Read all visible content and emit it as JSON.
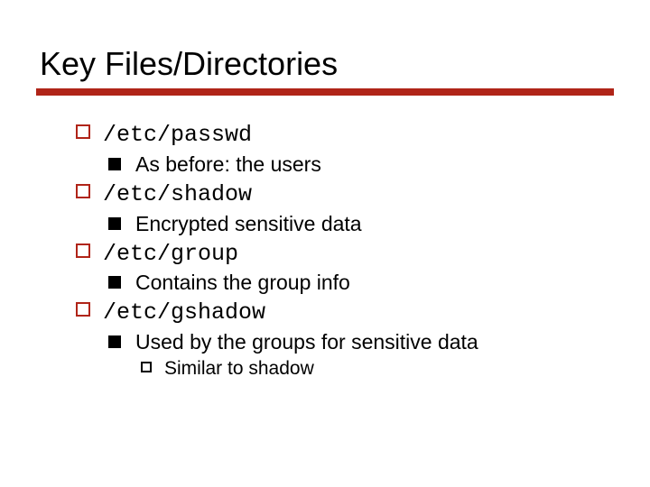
{
  "title": "Key Files/Directories",
  "colors": {
    "accent": "#b02418"
  },
  "items": [
    {
      "label": "/etc/passwd",
      "sub": "As before: the users"
    },
    {
      "label": "/etc/shadow",
      "sub": "Encrypted sensitive data"
    },
    {
      "label": "/etc/group",
      "sub": "Contains the group info"
    },
    {
      "label": "/etc/gshadow",
      "sub": "Used by the groups for sensitive data",
      "subsub": "Similar to shadow"
    }
  ]
}
